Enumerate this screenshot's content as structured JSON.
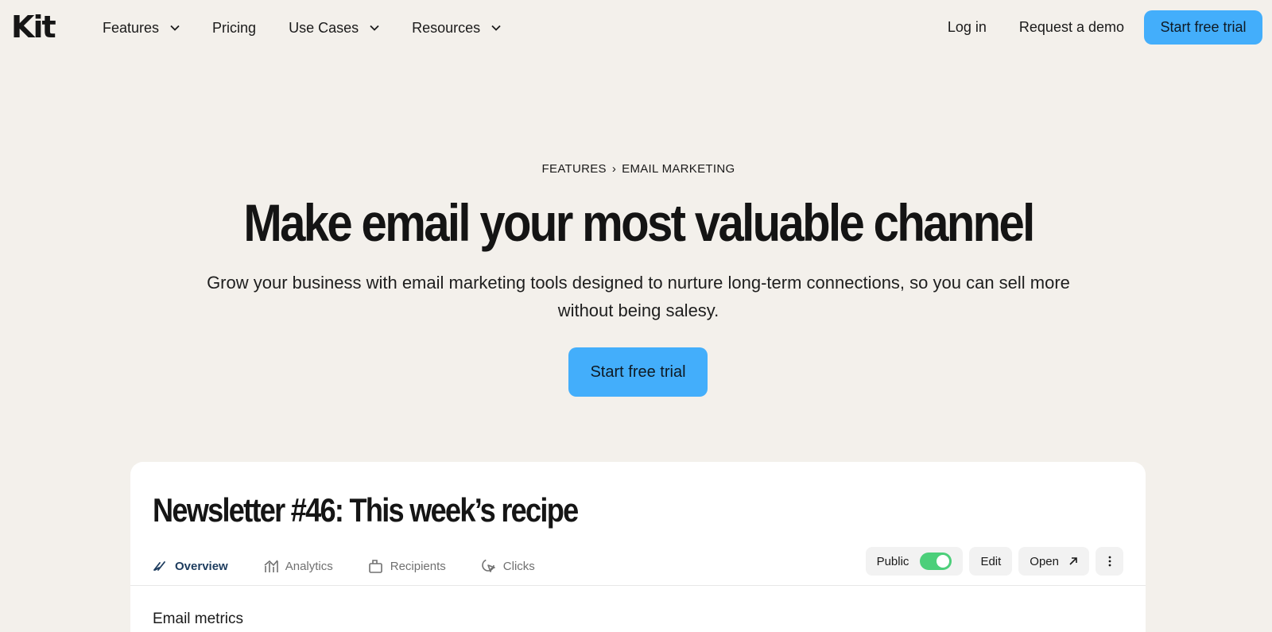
{
  "nav": {
    "logo": "Kit",
    "links": [
      {
        "label": "Features",
        "dropdown": true
      },
      {
        "label": "Pricing",
        "dropdown": false
      },
      {
        "label": "Use Cases",
        "dropdown": true
      },
      {
        "label": "Resources",
        "dropdown": true
      }
    ],
    "login": "Log in",
    "demo": "Request a demo",
    "cta": "Start free trial"
  },
  "hero": {
    "breadcrumb_1": "FEATURES",
    "breadcrumb_sep": "›",
    "breadcrumb_2": "EMAIL MARKETING",
    "title": "Make email your most valuable channel",
    "subtitle": "Grow your business with email marketing tools designed to nurture long-term connections, so you can sell more without being salesy.",
    "cta": "Start free trial"
  },
  "card": {
    "title": "Newsletter #46: This week’s recipe",
    "tabs": [
      {
        "label": "Overview",
        "icon": "overview-icon",
        "active": true
      },
      {
        "label": "Analytics",
        "icon": "analytics-icon",
        "active": false
      },
      {
        "label": "Recipients",
        "icon": "recipients-icon",
        "active": false
      },
      {
        "label": "Clicks",
        "icon": "clicks-icon",
        "active": false
      }
    ],
    "public_label": "Public",
    "public_on": true,
    "edit_label": "Edit",
    "open_label": "Open",
    "section": "Email metrics"
  },
  "colors": {
    "background": "#f3f0eb",
    "accent": "#43aefb",
    "toggle_on": "#4ccf7a",
    "active_tab": "#1d3c5e"
  }
}
